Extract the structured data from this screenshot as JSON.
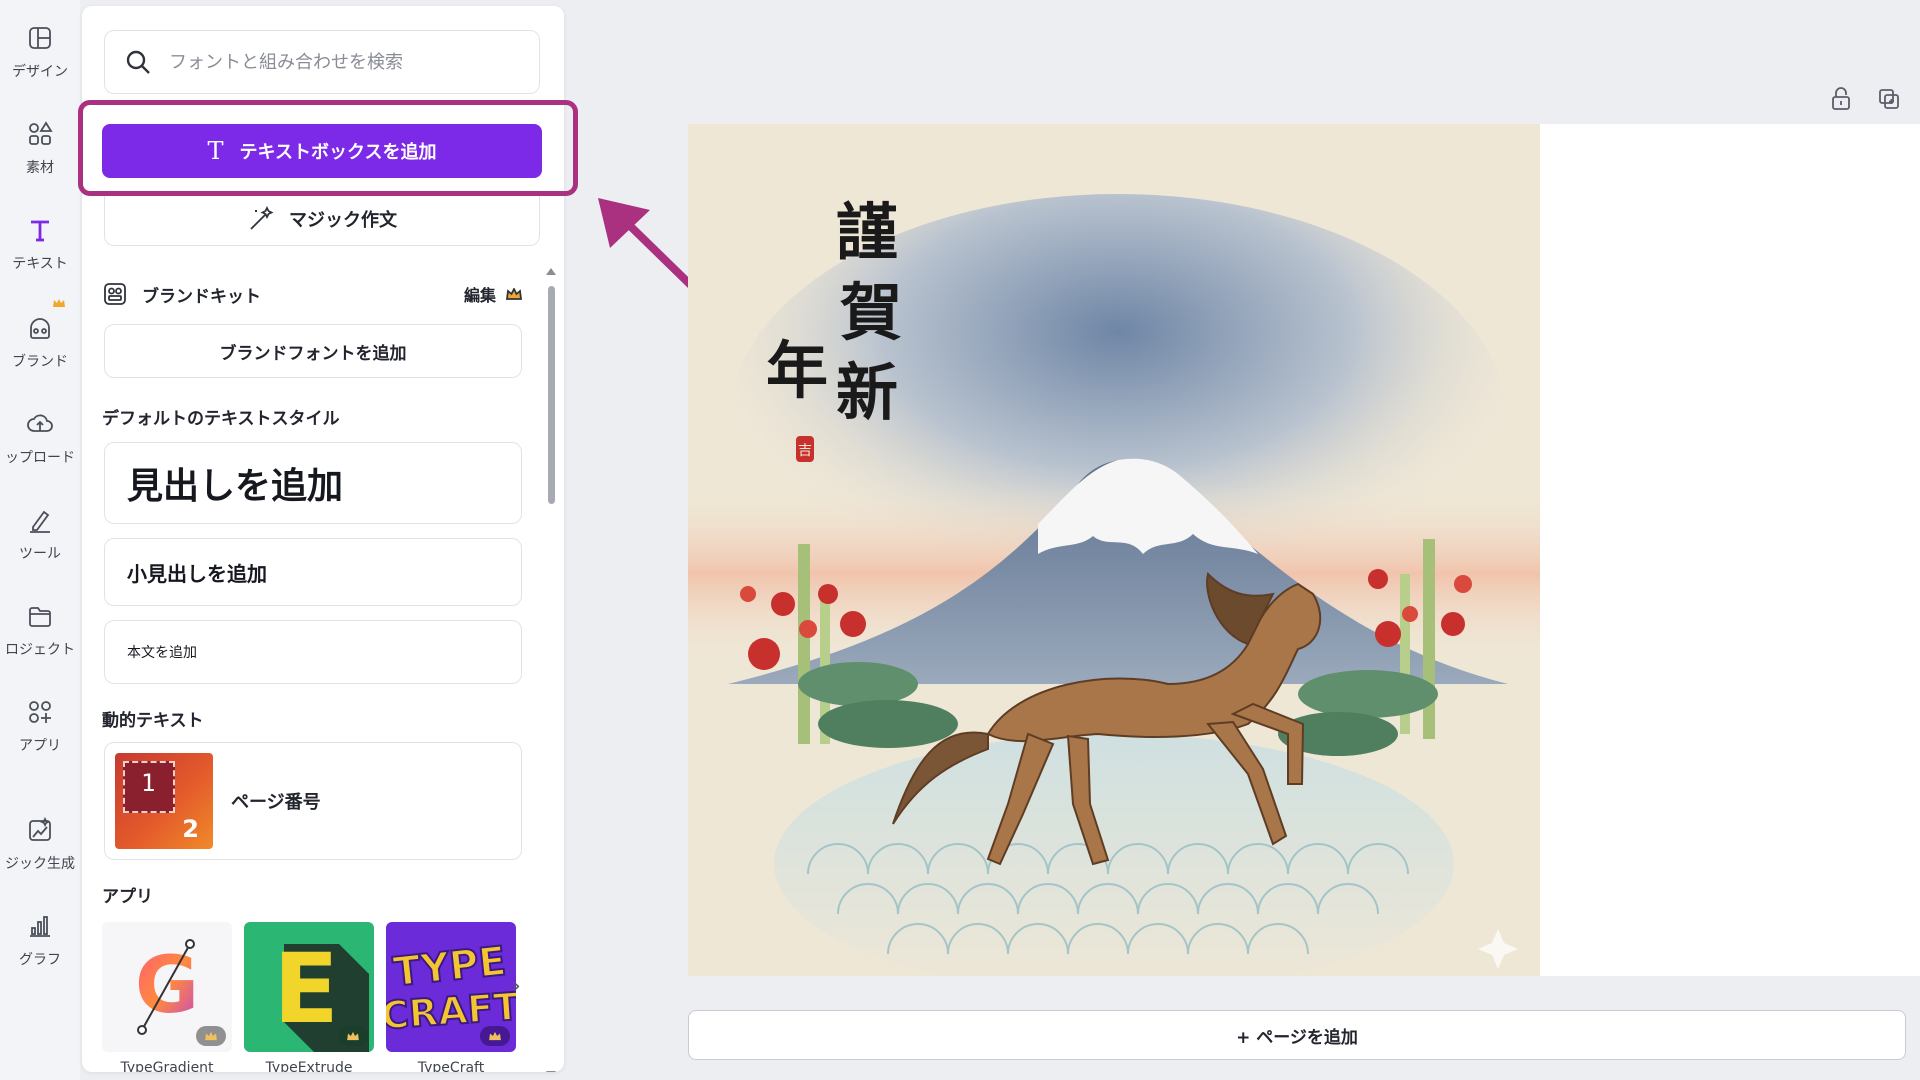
{
  "rail": {
    "items": [
      {
        "label": "デザイン",
        "icon": "layout-icon"
      },
      {
        "label": "素材",
        "icon": "elements-icon"
      },
      {
        "label": "テキスト",
        "icon": "text-icon"
      },
      {
        "label": "ブランド",
        "icon": "brand-icon"
      },
      {
        "label": "ップロード",
        "icon": "upload-icon"
      },
      {
        "label": "ツール",
        "icon": "tools-icon"
      },
      {
        "label": "ロジェクト",
        "icon": "folder-icon"
      },
      {
        "label": "アプリ",
        "icon": "apps-icon"
      },
      {
        "label": "ジック生成",
        "icon": "magic-media-icon"
      },
      {
        "label": "グラフ",
        "icon": "chart-icon"
      }
    ],
    "active": "テキスト"
  },
  "panel": {
    "search_placeholder": "フォントと組み合わせを検索",
    "add_textbox_label": "テキストボックスを追加",
    "magic_write_label": "マジック作文",
    "brand_kit": {
      "title": "ブランドキット",
      "edit_label": "編集",
      "add_font_label": "ブランドフォントを追加"
    },
    "default_styles": {
      "title": "デフォルトのテキストスタイル",
      "heading": "見出しを追加",
      "subheading": "小見出しを追加",
      "body": "本文を追加"
    },
    "dynamic_text": {
      "title": "動的テキスト",
      "page_number_label": "ページ番号",
      "thumb_numbers": [
        "1",
        "2"
      ]
    },
    "apps": {
      "title": "アプリ",
      "items": [
        {
          "name": "TypeGradient",
          "icon": "typegradient-logo"
        },
        {
          "name": "TypeExtrude",
          "icon": "typeextrude-logo"
        },
        {
          "name": "TypeCraft",
          "icon": "typecraft-logo"
        }
      ],
      "typecraft_logo_text": [
        "TYPE",
        "CRAFT"
      ],
      "typeextrude_logo_text": "E",
      "typegradient_logo_text": "G"
    }
  },
  "canvas": {
    "artwork_text": [
      "謹",
      "賀",
      "新",
      "年"
    ],
    "artwork_seal": "吉",
    "add_page_label": "+ ページを追加"
  },
  "colors": {
    "accent": "#7d2ae8",
    "annotation": "#a9317f"
  }
}
